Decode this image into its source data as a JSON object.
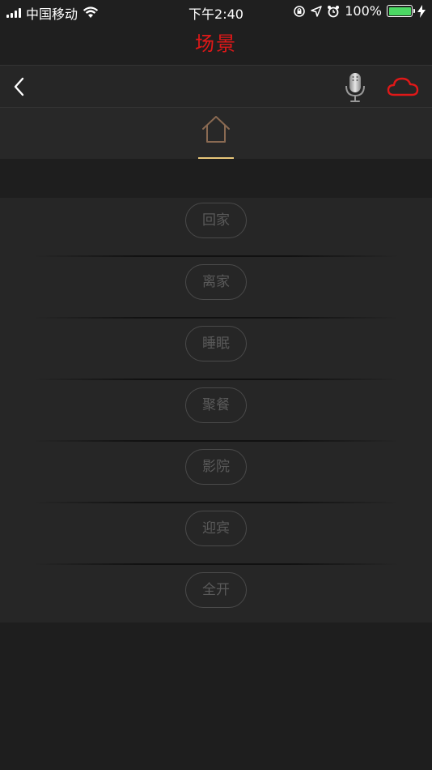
{
  "status": {
    "carrier": "中国移动",
    "time": "下午2:40",
    "battery_percent": "100%",
    "battery_level": 1.0
  },
  "header": {
    "title": "场景",
    "title_color": "#e01818"
  },
  "toolbar": {
    "back_icon": "chevron-left-icon",
    "mic_icon": "microphone-icon",
    "cloud_icon": "cloud-icon"
  },
  "tabs": [
    {
      "icon": "home-icon",
      "selected": true
    }
  ],
  "scenes": [
    {
      "label": "回家"
    },
    {
      "label": "离家"
    },
    {
      "label": "睡眠"
    },
    {
      "label": "聚餐"
    },
    {
      "label": "影院"
    },
    {
      "label": "迎宾"
    },
    {
      "label": "全开"
    }
  ]
}
